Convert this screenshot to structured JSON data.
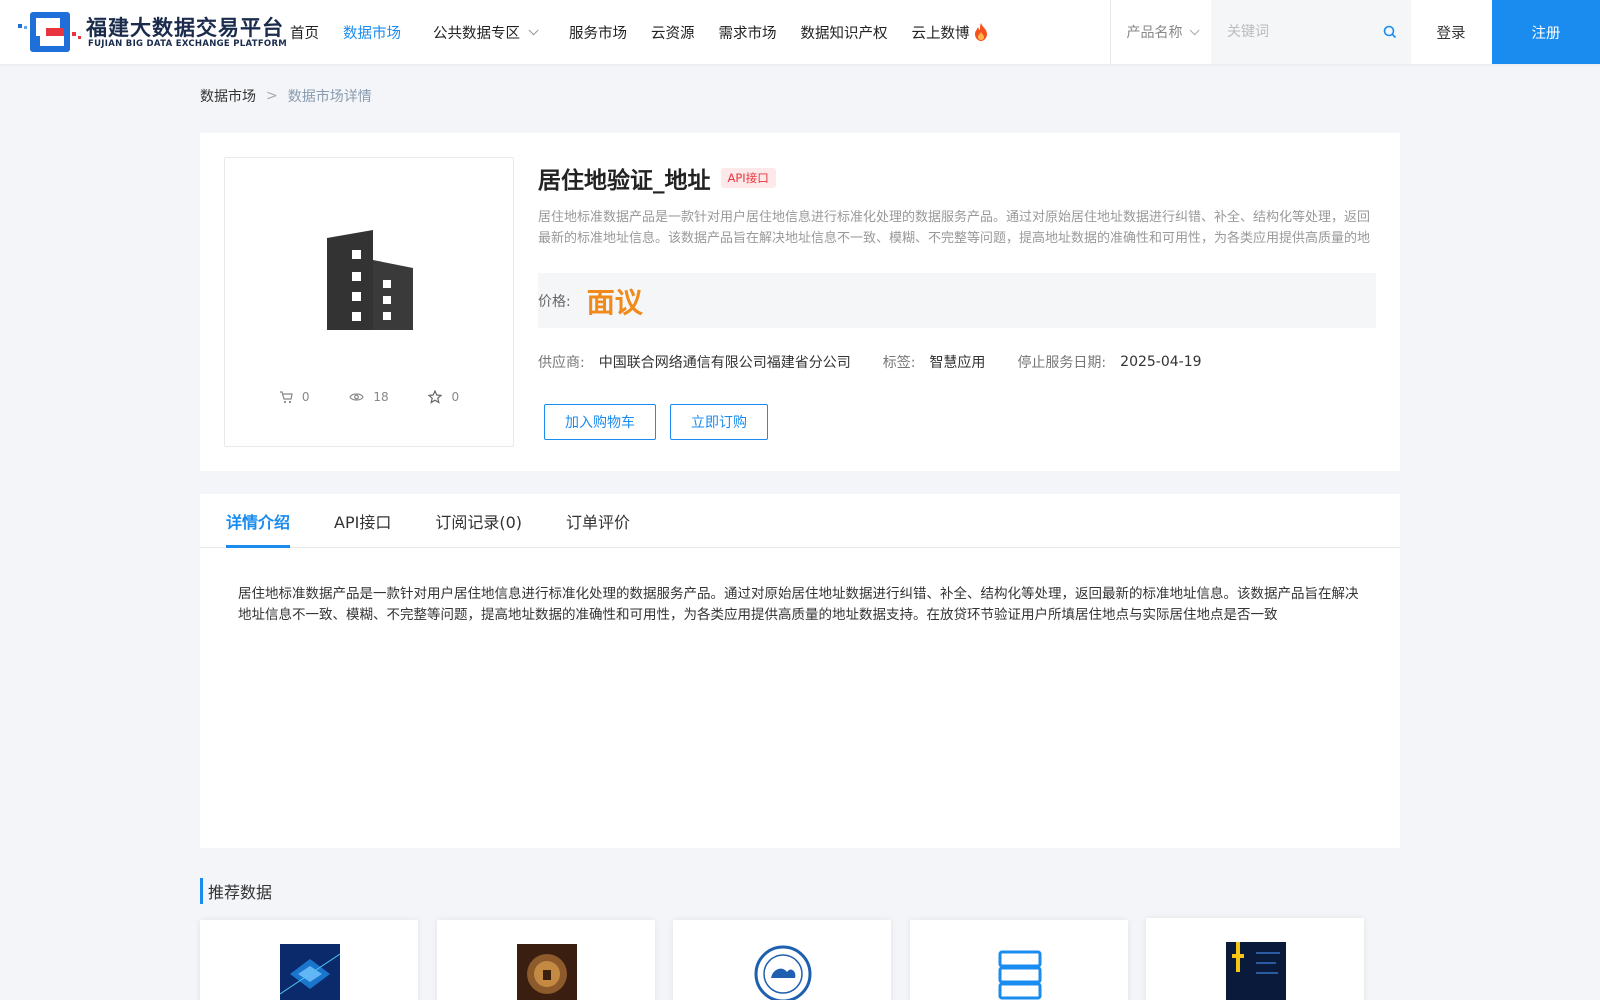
{
  "header": {
    "logo_cn": "福建大数据交易平台",
    "logo_en": "FUJIAN BIG DATA EXCHANGE  PLATFORM",
    "nav": [
      {
        "label": "首页"
      },
      {
        "label": "数据市场"
      },
      {
        "label": "公共数据专区"
      },
      {
        "label": "服务市场"
      },
      {
        "label": "云资源"
      },
      {
        "label": "需求市场"
      },
      {
        "label": "数据知识产权"
      },
      {
        "label": "云上数博"
      }
    ],
    "search_category": "产品名称",
    "search_placeholder": "关键词",
    "login": "登录",
    "register": "注册"
  },
  "breadcrumb": {
    "home": "数据市场",
    "separator": ">",
    "current": "数据市场详情"
  },
  "product": {
    "title": "居住地验证_地址",
    "tag": "API接口",
    "description": "居住地标准数据产品是一款针对用户居住地信息进行标准化处理的数据服务产品。通过对原始居住地址数据进行纠错、补全、结构化等处理，返回最新的标准地址信息。该数据产品旨在解决地址信息不一致、模糊、不完整等问题，提高地址数据的准确性和可用性，为各类应用提供高质量的地址数据支持。",
    "price_label": "价格:",
    "price_value": "面议",
    "supplier_label": "供应商:",
    "supplier_value": "中国联合网络通信有限公司福建省分公司",
    "tag_label": "标签:",
    "tag_value": "智慧应用",
    "stop_date_label": "停止服务日期:",
    "stop_date_value": "2025-04-19",
    "stats": {
      "cart": "0",
      "views": "18",
      "favorites": "0"
    },
    "add_cart": "加入购物车",
    "subscribe": "立即订购"
  },
  "tabs": [
    {
      "label": "详情介绍"
    },
    {
      "label": "API接口"
    },
    {
      "label": "订阅记录(0)"
    },
    {
      "label": "订单评价"
    }
  ],
  "detail_text": "居住地标准数据产品是一款针对用户居住地信息进行标准化处理的数据服务产品。通过对原始居住地址数据进行纠错、补全、结构化等处理，返回最新的标准地址信息。该数据产品旨在解决地址信息不一致、模糊、不完整等问题，提高地址数据的准确性和可用性，为各类应用提供高质量的地址数据支持。在放贷环节验证用户所填居住地点与实际居住地点是否一致",
  "recommend": {
    "title": "推荐数据"
  },
  "colors": {
    "primary": "#1a8cf0",
    "price": "#f08a1a",
    "tag_bg": "#fde8ea",
    "tag_text": "#e8343c"
  }
}
